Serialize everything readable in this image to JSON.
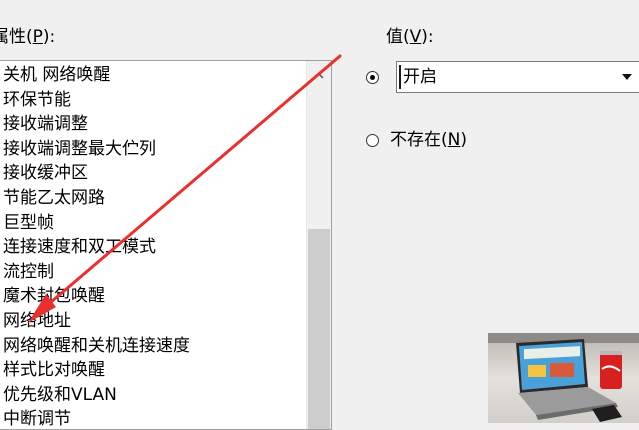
{
  "properties": {
    "label_text": "属性(",
    "label_key": "P",
    "label_end": "):",
    "items": [
      "关机 网络唤醒",
      "环保节能",
      "接收端调整",
      "接收端调整最大伫列",
      "接收缓冲区",
      "节能乙太网路",
      "巨型帧",
      "连接速度和双工模式",
      "流控制",
      "魔术封包唤醒",
      "网络地址",
      "网络唤醒和关机连接速度",
      "样式比对唤醒",
      "优先级和VLAN",
      "中断调节"
    ]
  },
  "value": {
    "label_text": "值(",
    "label_key": "V",
    "label_end": "):",
    "selected": "开启",
    "not_exist_text": "不存在(",
    "not_exist_key": "N",
    "not_exist_end": ")"
  },
  "icons": {
    "scroll_up": "chevron-up-icon",
    "dropdown": "triangle-down-icon",
    "annotation": "red-arrow"
  },
  "colors": {
    "annotation_arrow": "#e8312f",
    "background": "#f0f0f0"
  }
}
